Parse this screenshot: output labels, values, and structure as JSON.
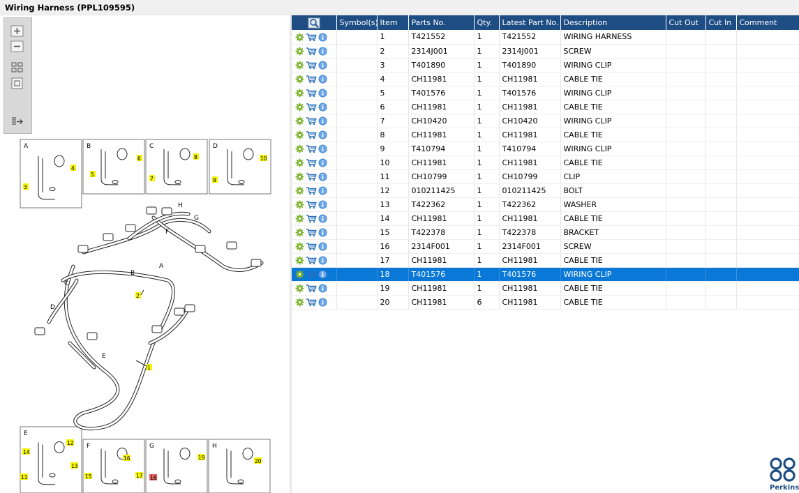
{
  "window": {
    "title": "Wiring Harness (PPL109595)"
  },
  "toolbox": {
    "buttons": [
      "zoom-in-icon",
      "zoom-out-icon",
      "fit-all-icon",
      "fit-window-icon",
      "export-icon"
    ]
  },
  "illustration": {
    "panels": [
      {
        "letter": "A",
        "callouts": [
          "4",
          "3"
        ]
      },
      {
        "letter": "B",
        "callouts": [
          "6",
          "5"
        ]
      },
      {
        "letter": "C",
        "callouts": [
          "8",
          "7"
        ]
      },
      {
        "letter": "D",
        "callouts": [
          "10",
          "9"
        ]
      },
      {
        "letter": "E",
        "callouts": [
          "12",
          "14",
          "13",
          "11"
        ]
      },
      {
        "letter": "F",
        "callouts": [
          "16",
          "17",
          "15"
        ]
      },
      {
        "letter": "G",
        "callouts": [
          "19",
          "18"
        ]
      },
      {
        "letter": "H",
        "callouts": [
          "20"
        ]
      }
    ],
    "main_labels": [
      "H",
      "G",
      "F",
      "A",
      "B",
      "C",
      "D",
      "E"
    ],
    "main_callouts": [
      "2",
      "1"
    ]
  },
  "table": {
    "columns": [
      "",
      "Symbol(s)",
      "Item",
      "Parts No.",
      "Qty.",
      "Latest Part No.",
      "Description",
      "Cut Out",
      "Cut In",
      "Comment"
    ],
    "selected_item": "18",
    "rows": [
      {
        "item": "1",
        "part": "T421552",
        "qty": "1",
        "latest": "T421552",
        "desc": "WIRING HARNESS"
      },
      {
        "item": "2",
        "part": "2314J001",
        "qty": "1",
        "latest": "2314J001",
        "desc": "SCREW"
      },
      {
        "item": "3",
        "part": "T401890",
        "qty": "1",
        "latest": "T401890",
        "desc": "WIRING CLIP"
      },
      {
        "item": "4",
        "part": "CH11981",
        "qty": "1",
        "latest": "CH11981",
        "desc": "CABLE TIE"
      },
      {
        "item": "5",
        "part": "T401576",
        "qty": "1",
        "latest": "T401576",
        "desc": "WIRING CLIP"
      },
      {
        "item": "6",
        "part": "CH11981",
        "qty": "1",
        "latest": "CH11981",
        "desc": "CABLE TIE"
      },
      {
        "item": "7",
        "part": "CH10420",
        "qty": "1",
        "latest": "CH10420",
        "desc": "WIRING CLIP"
      },
      {
        "item": "8",
        "part": "CH11981",
        "qty": "1",
        "latest": "CH11981",
        "desc": "CABLE TIE"
      },
      {
        "item": "9",
        "part": "T410794",
        "qty": "1",
        "latest": "T410794",
        "desc": "WIRING CLIP"
      },
      {
        "item": "10",
        "part": "CH11981",
        "qty": "1",
        "latest": "CH11981",
        "desc": "CABLE TIE"
      },
      {
        "item": "11",
        "part": "CH10799",
        "qty": "1",
        "latest": "CH10799",
        "desc": "CLIP"
      },
      {
        "item": "12",
        "part": "010211425",
        "qty": "1",
        "latest": "010211425",
        "desc": "BOLT"
      },
      {
        "item": "13",
        "part": "T422362",
        "qty": "1",
        "latest": "T422362",
        "desc": "WASHER"
      },
      {
        "item": "14",
        "part": "CH11981",
        "qty": "1",
        "latest": "CH11981",
        "desc": "CABLE TIE"
      },
      {
        "item": "15",
        "part": "T422378",
        "qty": "1",
        "latest": "T422378",
        "desc": "BRACKET"
      },
      {
        "item": "16",
        "part": "2314F001",
        "qty": "1",
        "latest": "2314F001",
        "desc": "SCREW"
      },
      {
        "item": "17",
        "part": "CH11981",
        "qty": "1",
        "latest": "CH11981",
        "desc": "CABLE TIE"
      },
      {
        "item": "18",
        "part": "T401576",
        "qty": "1",
        "latest": "T401576",
        "desc": "WIRING CLIP"
      },
      {
        "item": "19",
        "part": "CH11981",
        "qty": "1",
        "latest": "CH11981",
        "desc": "CABLE TIE"
      },
      {
        "item": "20",
        "part": "CH11981",
        "qty": "6",
        "latest": "CH11981",
        "desc": "CABLE TIE"
      }
    ],
    "row_icons": [
      "gear-icon",
      "cart-icon",
      "info-icon"
    ]
  },
  "brand": {
    "name": "Perkins",
    "color": "#1e4d84"
  },
  "colors": {
    "header": "#1e4d84",
    "selection": "#0a78d7",
    "callout": "#f5f500",
    "callout_selected": "#e86060"
  }
}
